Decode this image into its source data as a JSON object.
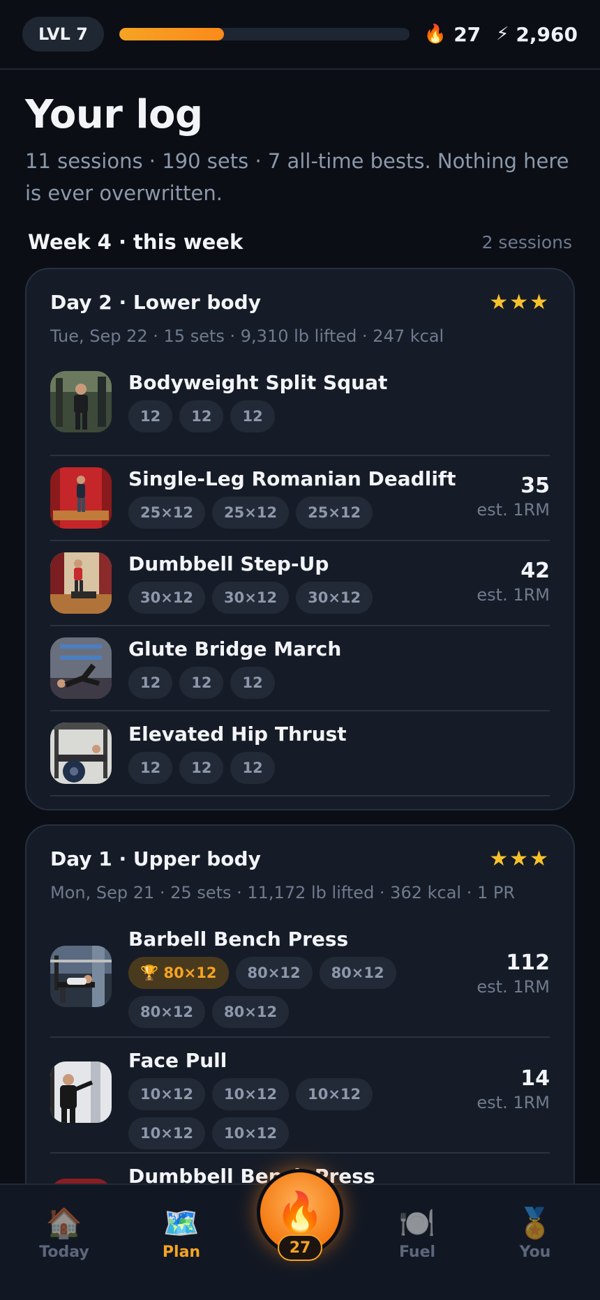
{
  "topbar": {
    "level_label": "LVL 7",
    "xp_progress": 0.36,
    "streak": "27",
    "points": "2,960",
    "streak_icon": "flame-icon",
    "points_icon": "bolt-icon"
  },
  "header": {
    "title": "Your log",
    "subtitle": "11 sessions · 190 sets · 7 all-time bests. Nothing here is ever overwritten."
  },
  "week": {
    "title": "Week 4 · this week",
    "count": "2 sessions"
  },
  "sessions": [
    {
      "title": "Day 2 · Lower body",
      "stars": "★★★",
      "meta": "Tue, Sep 22 · 15 sets · 9,310 lb lifted · 247 kcal",
      "exercises": [
        {
          "name": "Bodyweight Split Squat",
          "sets": [
            "12",
            "12",
            "12"
          ]
        },
        {
          "name": "Single-Leg Romanian Deadlift",
          "sets": [
            "25×12",
            "25×12",
            "25×12"
          ],
          "rm": "35",
          "rm_label": "est. 1RM"
        },
        {
          "name": "Dumbbell Step-Up",
          "sets": [
            "30×12",
            "30×12",
            "30×12"
          ],
          "rm": "42",
          "rm_label": "est. 1RM"
        },
        {
          "name": "Glute Bridge March",
          "sets": [
            "12",
            "12",
            "12"
          ]
        },
        {
          "name": "Elevated Hip Thrust",
          "sets": [
            "12",
            "12",
            "12"
          ]
        }
      ]
    },
    {
      "title": "Day 1 · Upper body",
      "stars": "★★★",
      "meta": "Mon, Sep 21 · 25 sets · 11,172 lb lifted · 362 kcal · 1 PR",
      "exercises": [
        {
          "name": "Barbell Bench Press",
          "pr_set": "🏆 80×12",
          "sets": [
            "80×12",
            "80×12",
            "80×12",
            "80×12"
          ],
          "rm": "112",
          "rm_label": "est. 1RM"
        },
        {
          "name": "Face Pull",
          "sets": [
            "10×12",
            "10×12",
            "10×12",
            "10×12",
            "10×12"
          ],
          "rm": "14",
          "rm_label": "est. 1RM"
        },
        {
          "name": "Dumbbell Bench Press"
        }
      ]
    }
  ],
  "nav": {
    "items": [
      {
        "label": "Today",
        "icon": "home-icon"
      },
      {
        "label": "Plan",
        "icon": "map-icon"
      },
      {
        "label": "Fuel",
        "icon": "plate-icon"
      },
      {
        "label": "You",
        "icon": "medal-icon"
      }
    ],
    "fab_badge": "27",
    "fab_icon": "flame-icon"
  },
  "colors": {
    "accent": "#f6a324",
    "background": "#0b0e15",
    "card": "#161c27",
    "star": "#f8c22c"
  }
}
